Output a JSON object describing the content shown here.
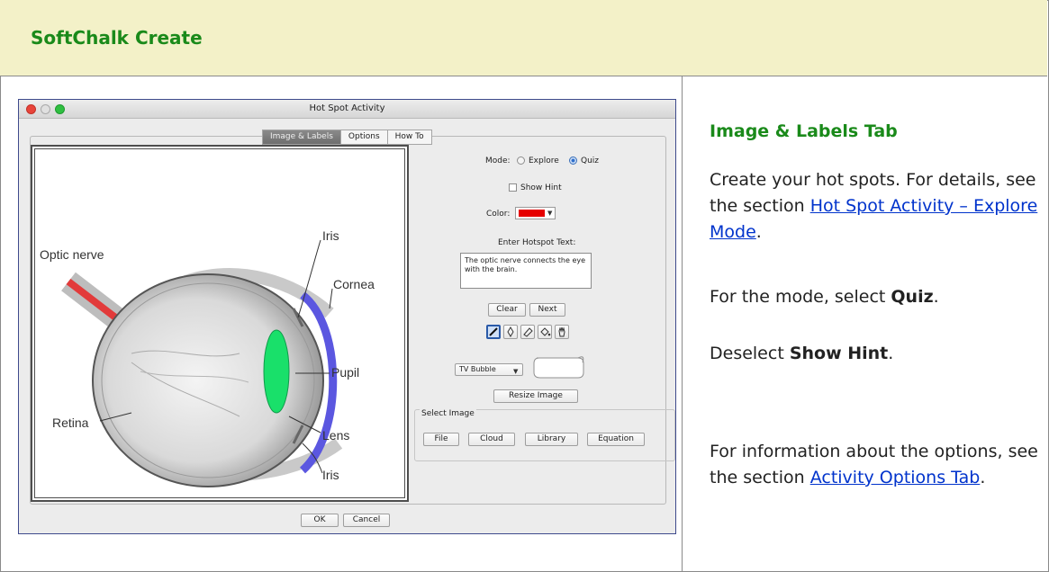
{
  "header": {
    "title": "SoftChalk Create"
  },
  "dialog": {
    "title": "Hot Spot Activity",
    "tabs": [
      {
        "label": "Image & Labels",
        "active": true
      },
      {
        "label": "Options",
        "active": false
      },
      {
        "label": "How To",
        "active": false
      }
    ],
    "image": {
      "alt_labels": [
        "Optic nerve",
        "Iris",
        "Cornea",
        "Pupil",
        "Lens",
        "Retina",
        "Iris"
      ]
    },
    "controls": {
      "mode_label": "Mode:",
      "mode_explore": "Explore",
      "mode_quiz": "Quiz",
      "mode_selected": "Quiz",
      "show_hint_label": "Show Hint",
      "show_hint_checked": false,
      "color_label": "Color:",
      "color_value": "#e60000",
      "hotspot_text_label": "Enter Hotspot Text:",
      "hotspot_text_value": "The optic nerve connects the eye with the brain.",
      "clear_label": "Clear",
      "next_label": "Next",
      "tools": [
        "pen-icon",
        "pencil-icon",
        "eraser-icon",
        "fill-icon",
        "hand-icon"
      ],
      "bubble_select_value": "TV Bubble",
      "resize_label": "Resize Image",
      "select_image_label": "Select Image",
      "file_label": "File",
      "cloud_label": "Cloud",
      "library_label": "Library",
      "equation_label": "Equation"
    },
    "ok_label": "OK",
    "cancel_label": "Cancel"
  },
  "content": {
    "heading": "Image & Labels Tab",
    "p1_text": "Create your hot spots. For details, see the section ",
    "p1_link": "Hot Spot Activity – Explore Mode",
    "p1_end": ".",
    "p2_text": "For the mode, select ",
    "p2_bold": "Quiz",
    "p2_end": ".",
    "p3_text": "Deselect ",
    "p3_bold": "Show Hint",
    "p3_end": ".",
    "p4_text": "For information about the options, see the section ",
    "p4_link": "Activity Options Tab",
    "p4_end": "."
  },
  "colors": {
    "accent_green": "#1a8a1a",
    "header_bg": "#f3f1c8",
    "link": "#0033cc",
    "hotspot_blue": "#5b57e0",
    "hotspot_green": "#19e06a"
  }
}
